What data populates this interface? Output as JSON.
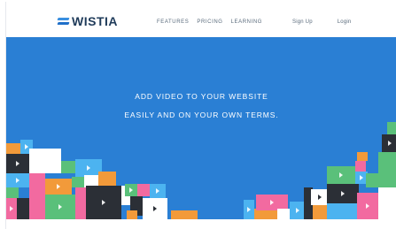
{
  "brand": {
    "name": "WISTIA"
  },
  "nav": {
    "links": [
      "FEATURES",
      "PRICING",
      "LEARNING"
    ],
    "signup": "Sign Up",
    "login": "Login"
  },
  "hero": {
    "line1": "ADD VIDEO TO YOUR WEBSITE",
    "line2": "EASILY AND ON YOUR OWN TERMS."
  },
  "colors": {
    "hero_blue": "#2a7fd4",
    "tile_palette": [
      "#2b2f36",
      "#f26aa0",
      "#f29a3a",
      "#5ac07a",
      "#4cb3f0",
      "#ffffff",
      "#a34f3c",
      "#1d6fb8"
    ]
  },
  "icons": [
    "logo-mark",
    "play-icon"
  ]
}
